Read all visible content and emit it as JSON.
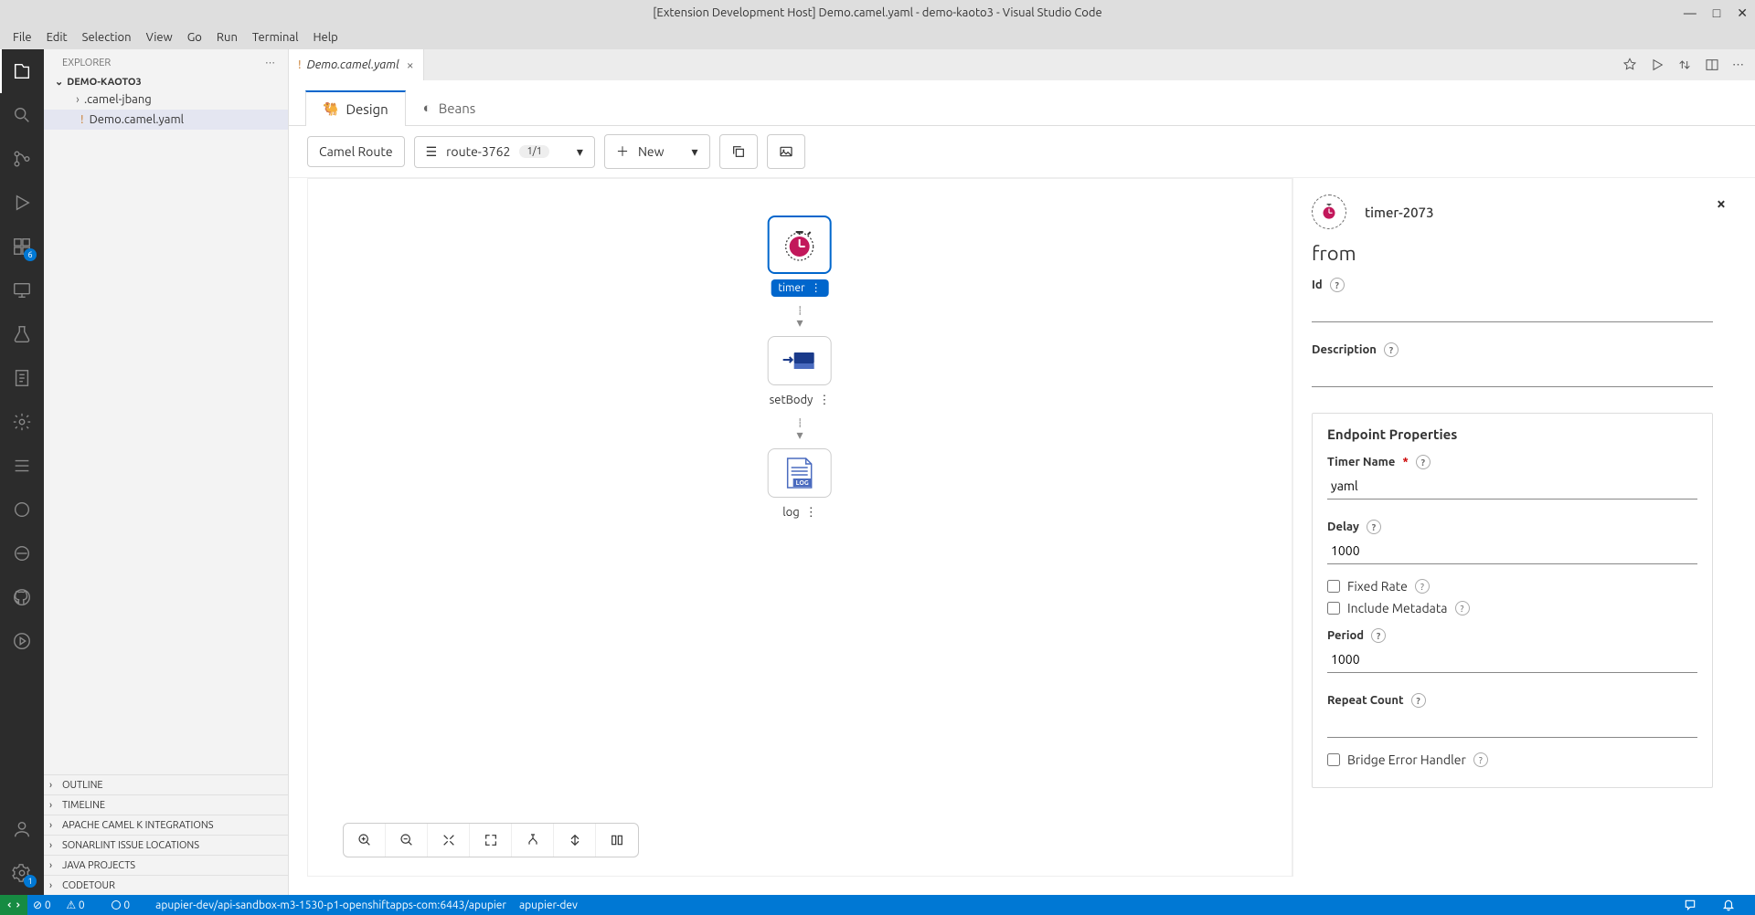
{
  "window": {
    "title": "[Extension Development Host] Demo.camel.yaml - demo-kaoto3 - Visual Studio Code"
  },
  "menu": {
    "items": [
      "File",
      "Edit",
      "Selection",
      "View",
      "Go",
      "Run",
      "Terminal",
      "Help"
    ]
  },
  "activitybar": {
    "extBadge": "6",
    "testBadge": "1"
  },
  "explorer": {
    "title": "EXPLORER",
    "folder": "DEMO-KAOTO3",
    "files": {
      "f0": ".camel-jbang",
      "f1": "Demo.camel.yaml"
    },
    "sections": {
      "outline": "OUTLINE",
      "timeline": "TIMELINE",
      "camelk": "APACHE CAMEL K INTEGRATIONS",
      "sonar": "SONARLINT ISSUE LOCATIONS",
      "java": "JAVA PROJECTS",
      "codetour": "CODETOUR"
    }
  },
  "tabs": {
    "active": "Demo.camel.yaml"
  },
  "kaoto": {
    "tabs": {
      "design": "Design",
      "beans": "Beans"
    },
    "toolbar": {
      "type": "Camel Route",
      "route": "route-3762",
      "count": "1/1",
      "new": "New"
    },
    "nodes": {
      "timer": "timer",
      "setBody": "setBody",
      "log": "log"
    },
    "props": {
      "title": "timer-2073",
      "subtitle": "from",
      "labels": {
        "id": "Id",
        "description": "Description",
        "section": "Endpoint Properties",
        "timerName": "Timer Name",
        "delay": "Delay",
        "fixedRate": "Fixed Rate",
        "includeMetadata": "Include Metadata",
        "period": "Period",
        "repeatCount": "Repeat Count",
        "bridgeError": "Bridge Error Handler"
      },
      "values": {
        "timerName": "yaml",
        "delay": "1000",
        "period": "1000"
      }
    }
  },
  "statusbar": {
    "errors": "0",
    "warnings": "0",
    "ports": "0",
    "cluster": "apupier-dev/api-sandbox-m3-1530-p1-openshiftapps-com:6443/apupier",
    "ns": "apupier-dev"
  }
}
